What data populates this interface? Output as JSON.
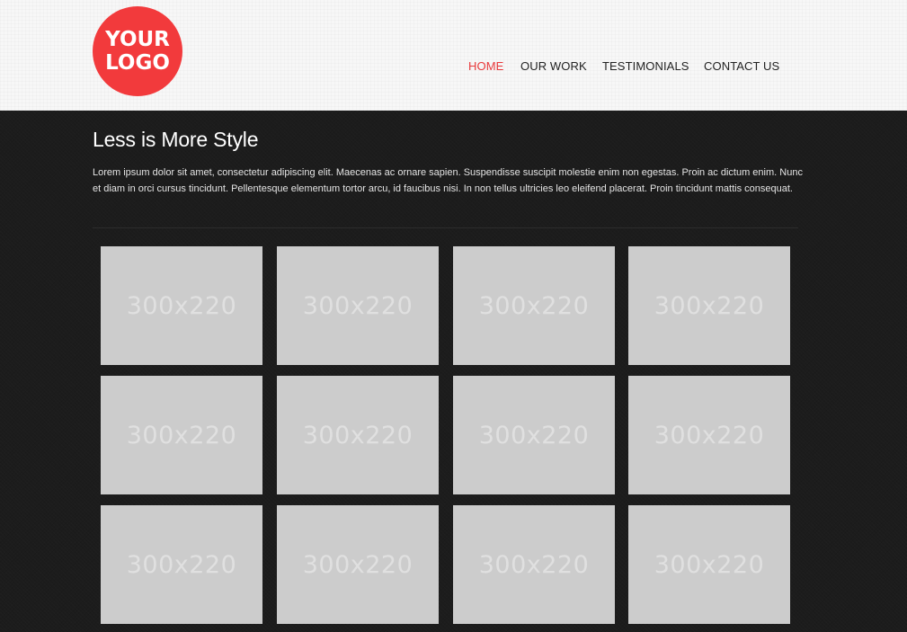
{
  "header": {
    "logo": {
      "line1": "YOUR",
      "line2": "LOGO"
    },
    "nav": [
      {
        "label": "HOME",
        "active": true
      },
      {
        "label": "OUR WORK",
        "active": false
      },
      {
        "label": "TESTIMONIALS",
        "active": false
      },
      {
        "label": "CONTACT US",
        "active": false
      }
    ]
  },
  "main": {
    "title": "Less is More Style",
    "intro": "Lorem ipsum dolor sit amet, consectetur adipiscing elit. Maecenas ac ornare sapien. Suspendisse suscipit molestie enim non egestas. Proin ac dictum enim. Nunc et diam in orci cursus tincidunt. Pellentesque elementum tortor arcu, id faucibus nisi. In non tellus ultricies leo eleifend placerat. Proin tincidunt mattis consequat.",
    "gallery": [
      "300x220",
      "300x220",
      "300x220",
      "300x220",
      "300x220",
      "300x220",
      "300x220",
      "300x220",
      "300x220",
      "300x220",
      "300x220",
      "300x220"
    ]
  },
  "colors": {
    "accent": "#e8393b",
    "logo_bg": "#f23a3c",
    "header_bg": "#f7f7f7",
    "body_bg": "#1c1c1c",
    "placeholder_bg": "#cccccc"
  }
}
